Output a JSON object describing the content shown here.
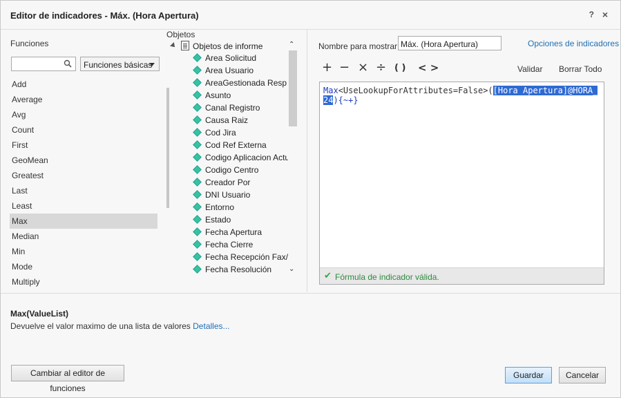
{
  "window": {
    "title": "Editor de indicadores - Máx. (Hora Apertura)",
    "help": "?",
    "close": "×"
  },
  "functions": {
    "label": "Funciones",
    "search_placeholder": "",
    "category": "Funciones básicas",
    "items": [
      "Add",
      "Average",
      "Avg",
      "Count",
      "First",
      "GeoMean",
      "Greatest",
      "Last",
      "Least",
      "Max",
      "Median",
      "Min",
      "Mode",
      "Multiply"
    ],
    "selected": "Max"
  },
  "objects": {
    "label": "Objetos",
    "root": "Objetos de informe",
    "items": [
      "Area Solicitud",
      "Area Usuario",
      "AreaGestionada Resp Pr",
      "Asunto",
      "Canal Registro",
      "Causa Raiz",
      "Cod Jira",
      "Cod Ref Externa",
      "Codigo Aplicacion Actual",
      "Codigo Centro",
      "Creador Por",
      "DNI Usuario",
      "Entorno",
      "Estado",
      "Fecha Apertura",
      "Fecha Cierre",
      "Fecha Recepción Fax/Ma",
      "Fecha Resolución"
    ]
  },
  "editor": {
    "display_label": "Nombre para mostrar:",
    "display_value": "Máx. (Hora Apertura)",
    "options_link": "Opciones de indicadores",
    "operators": [
      "+",
      "−",
      "×",
      "÷",
      "( )",
      "< >"
    ],
    "validate": "Validar",
    "clear_all": "Borrar Todo",
    "formula": {
      "fn": "Max",
      "mid": "<UseLookupForAttributes=False>(",
      "selected": "[Hora Apertura]@HORA_24",
      "end": "){~+}"
    },
    "status": "Fórmula de indicador válida."
  },
  "description": {
    "signature": "Max(ValueList)",
    "text": "Devuelve el valor maximo de una lista de valores ",
    "details": "Detalles..."
  },
  "buttons": {
    "switch": "Cambiar al editor de funciones",
    "save": "Guardar",
    "cancel": "Cancelar"
  }
}
